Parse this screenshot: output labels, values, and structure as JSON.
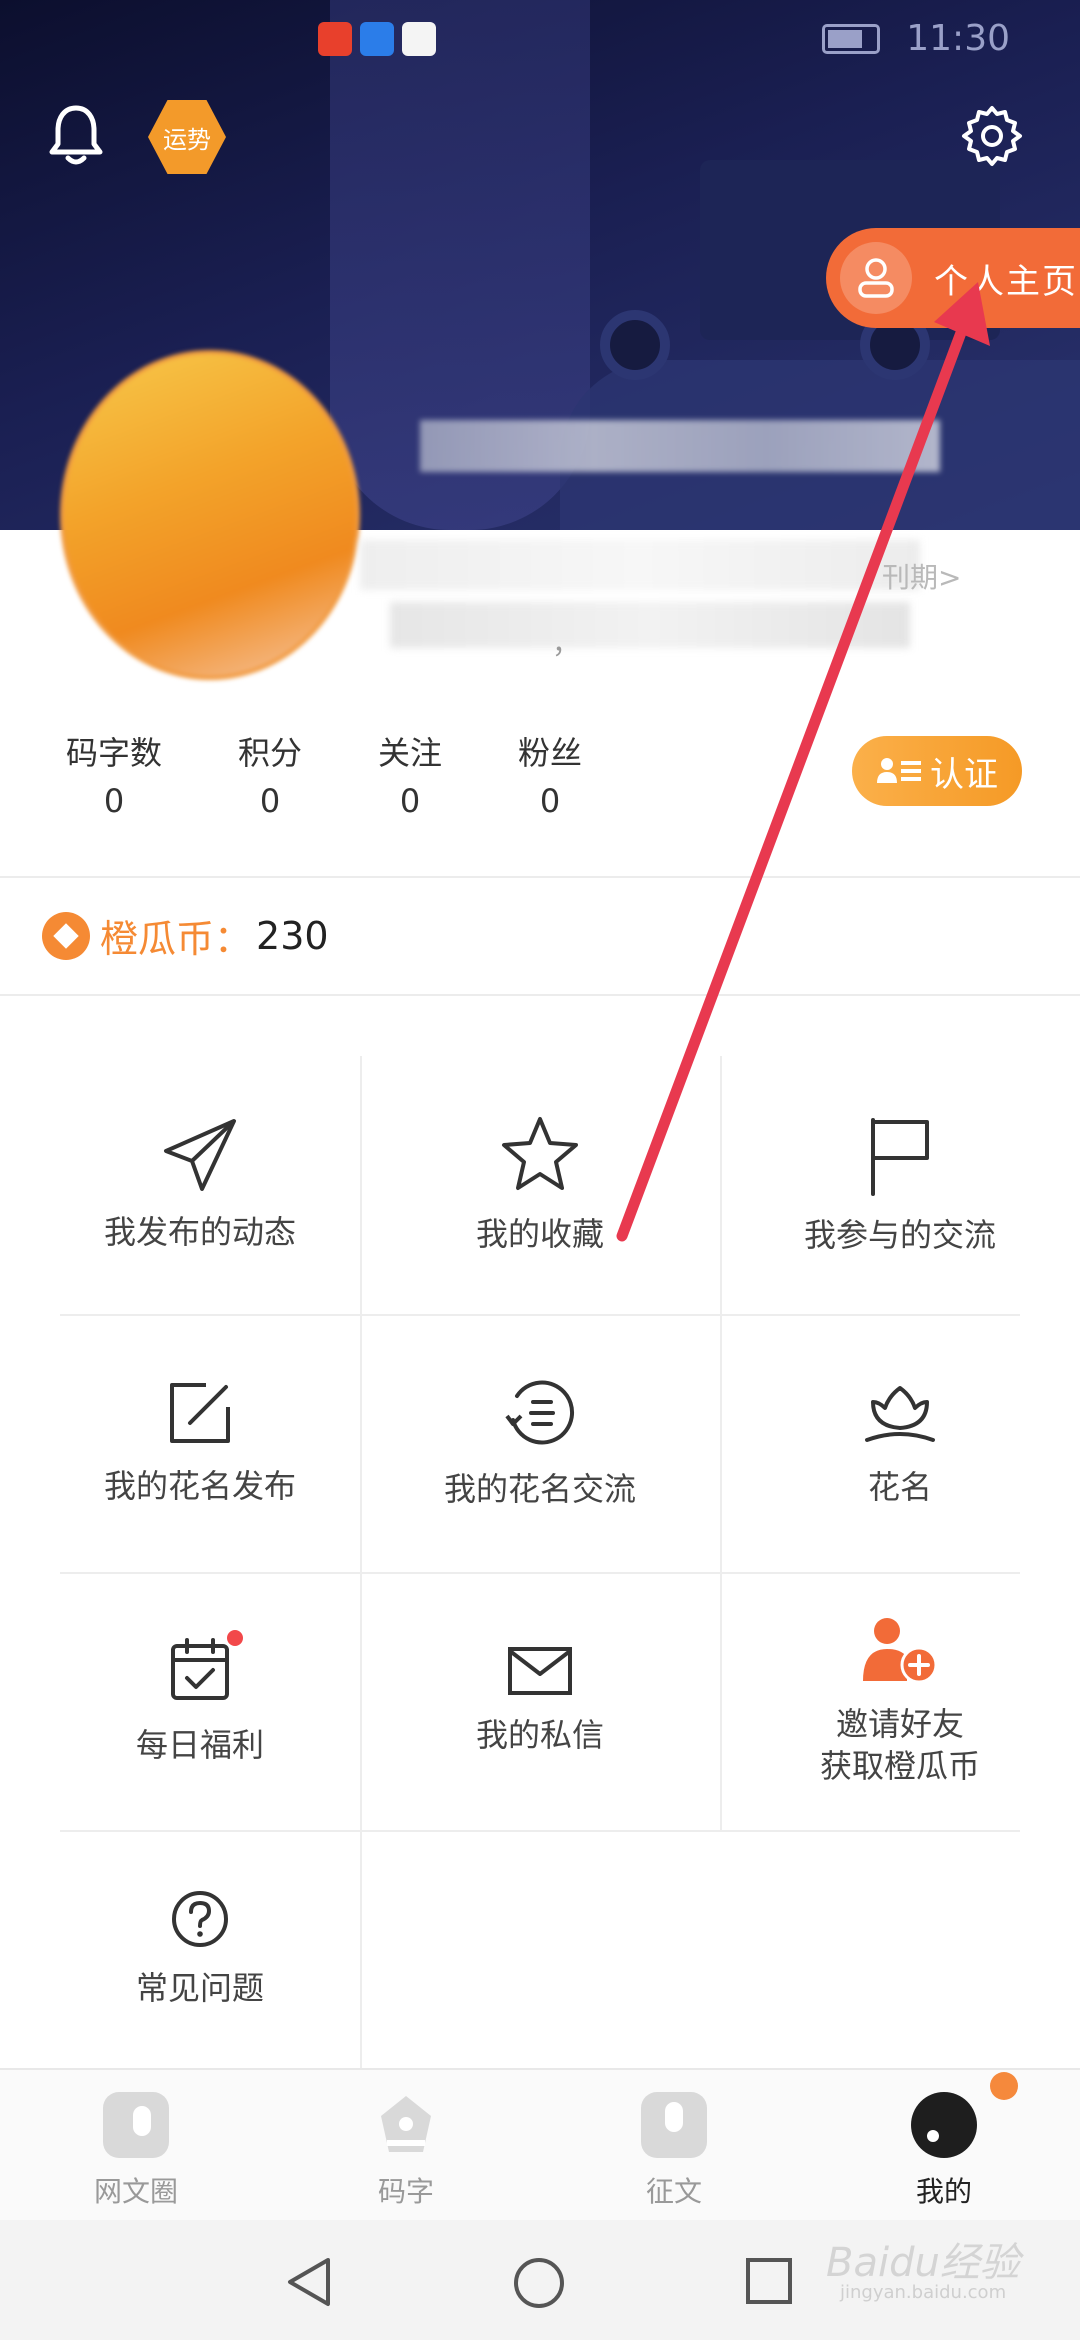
{
  "status_bar": {
    "time": "11:30"
  },
  "header": {
    "fortune_label": "运势",
    "profile_button_label": "个人主页",
    "fragment_right": "刊期>",
    "fragment_left": "，"
  },
  "stats": [
    {
      "label": "码字数",
      "value": "0"
    },
    {
      "label": "积分",
      "value": "0"
    },
    {
      "label": "关注",
      "value": "0"
    },
    {
      "label": "粉丝",
      "value": "0"
    }
  ],
  "verify_label": "认证",
  "coins": {
    "label": "橙瓜币：",
    "value": "230"
  },
  "menu": [
    {
      "label": "我发布的动态",
      "icon": "paper-plane-icon"
    },
    {
      "label": "我的收藏",
      "icon": "star-icon"
    },
    {
      "label": "我参与的交流",
      "icon": "flag-icon"
    },
    {
      "label": "我的花名发布",
      "icon": "edit-icon"
    },
    {
      "label": "我的花名交流",
      "icon": "history-icon"
    },
    {
      "label": "花名",
      "icon": "lotus-icon"
    },
    {
      "label": "每日福利",
      "icon": "calendar-check-icon"
    },
    {
      "label": "我的私信",
      "icon": "mail-icon"
    },
    {
      "label": "邀请好友\n获取橙瓜币",
      "icon": "invite-user-icon"
    },
    {
      "label": "常见问题",
      "icon": "question-icon"
    }
  ],
  "tabs": [
    {
      "label": "网文圈",
      "active": false
    },
    {
      "label": "码字",
      "active": false
    },
    {
      "label": "征文",
      "active": false
    },
    {
      "label": "我的",
      "active": true
    }
  ],
  "watermark": {
    "main": "Baidu经验",
    "sub": "jingyan.baidu.com"
  },
  "colors": {
    "accent": "#f58a34",
    "profile_button": "#f26b38",
    "arrow": "#e8394f"
  }
}
